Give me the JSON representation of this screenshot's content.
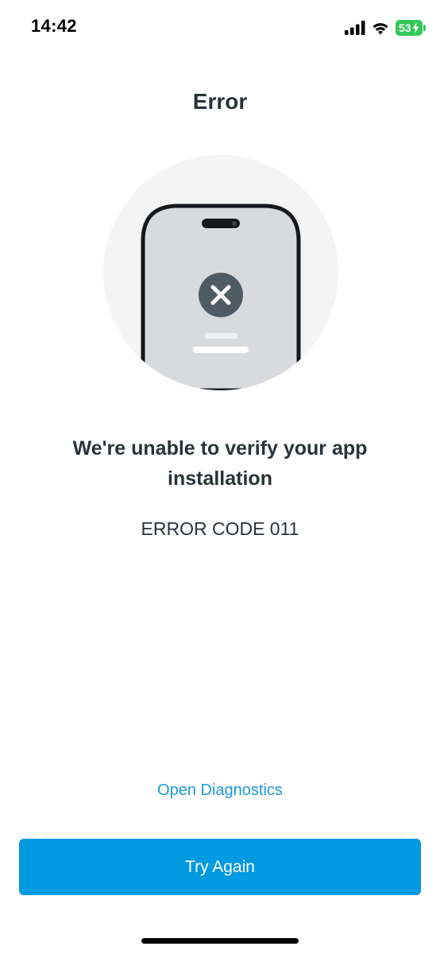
{
  "status_bar": {
    "time": "14:42",
    "battery": "53",
    "icons": [
      "cellular-signal-icon",
      "wifi-icon",
      "battery-charging-icon"
    ]
  },
  "header": {
    "title": "Error"
  },
  "illustration": {
    "icon": "phone-error-icon"
  },
  "content": {
    "message": "We're unable to verify your app installation",
    "error_code": "ERROR CODE 011"
  },
  "actions": {
    "diagnostics_label": "Open Diagnostics",
    "retry_label": "Try Again"
  },
  "colors": {
    "accent": "#0199df",
    "link": "#1a9ad8",
    "battery": "#34c759",
    "text": "#2a323a"
  }
}
